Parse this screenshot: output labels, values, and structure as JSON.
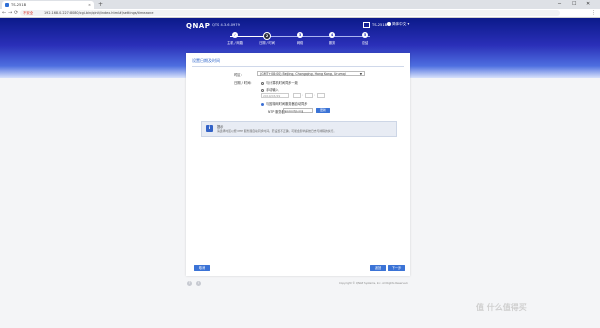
{
  "browser": {
    "tab_title": "TS-251B",
    "security_label": "不安全",
    "url": "192.168.0.227:8080/cgi-bin/qinit/index.html#/settings/timezone",
    "new_tab": "+",
    "minimize": "─",
    "maximize": "☐",
    "close": "✕",
    "back": "←",
    "forward": "→",
    "reload": "⟳",
    "menu": "⋮"
  },
  "header": {
    "logo": "QNAP",
    "version": "QTS 4.3.6.0979",
    "model": "TS-251B",
    "language": "简体中文",
    "progress": 0.25
  },
  "steps": [
    {
      "num": "✓",
      "label": "主机 / 网路"
    },
    {
      "num": "2",
      "label": "日期 / 时间"
    },
    {
      "num": "3",
      "label": "网络"
    },
    {
      "num": "4",
      "label": "服务"
    },
    {
      "num": "5",
      "label": "总结"
    }
  ],
  "card": {
    "title": "设置日期及时间",
    "timezone_label": "时区:",
    "timezone_value": "(GMT+08:00) Beijing, Chongqing, Hong Kong, Urumqi",
    "datetime_label": "日期 / 时间:",
    "opt1": "与计算机时间同步一致",
    "opt2": "手动输入",
    "date_placeholder": "2019/03/29",
    "opt3": "与因特网时间服务器自动同步",
    "ntp_label": "NTP 服务器:",
    "ntp_value": "pool.ntp.org",
    "update_btn": "更新",
    "info_icon": "i",
    "info_title": "提示",
    "info_body": "请选择时区以便 NTP 服务器自动同步时间。若设置不正确，可能会影响系统日志与排程的执行。",
    "cancel_btn": "取消",
    "prev_btn": "返回",
    "next_btn": "下一步"
  },
  "footer": {
    "copyright": "Copyright © QNAP Systems, Inc. All Rights Reserved."
  },
  "watermark": "值 什么值得买"
}
